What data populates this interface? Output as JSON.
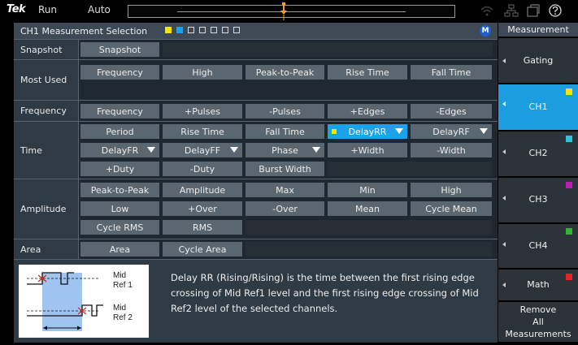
{
  "topbar": {
    "brand": "Tek",
    "run_state": "Run",
    "trigger_mode": "Auto",
    "icons": [
      "wifi-icon",
      "network-icon",
      "window-icon",
      "help-icon"
    ]
  },
  "panel": {
    "title": "CH1 Measurement Selection",
    "badge": "M",
    "square_colors": [
      "#f7e600",
      "#1aa3e8",
      "#d8d8d8",
      "#d8d8d8",
      "#d8d8d8",
      "#d8d8d8",
      "#d8d8d8"
    ]
  },
  "rows": {
    "snapshot": {
      "label": "Snapshot",
      "btn": "Snapshot"
    },
    "most_used": {
      "label": "Most Used",
      "btns": [
        "Frequency",
        "High",
        "Peak-to-Peak",
        "Rise Time",
        "Fall Time"
      ]
    },
    "frequency": {
      "label": "Frequency",
      "btns": [
        "Frequency",
        "+Pulses",
        "-Pulses",
        "+Edges",
        "-Edges"
      ]
    },
    "time": {
      "label": "Time",
      "r1": [
        "Period",
        "Rise Time",
        "Fall Time",
        "DelayRR",
        "DelayRF"
      ],
      "r2": [
        "DelayFR",
        "DelayFF",
        "Phase",
        "+Width",
        "-Width"
      ],
      "r3": [
        "+Duty",
        "-Duty",
        "Burst Width"
      ]
    },
    "amplitude": {
      "label": "Amplitude",
      "r1": [
        "Peak-to-Peak",
        "Amplitude",
        "Max",
        "Min",
        "High"
      ],
      "r2": [
        "Low",
        "+Over",
        "-Over",
        "Mean",
        "Cycle Mean"
      ],
      "r3": [
        "Cycle RMS",
        "RMS"
      ]
    },
    "area": {
      "label": "Area",
      "btns": [
        "Area",
        "Cycle Area"
      ]
    }
  },
  "description": {
    "text": "Delay RR (Rising/Rising) is the time between the first rising edge crossing of Mid Ref1 level and the first rising edge crossing of Mid Ref2 level of the selected channels.",
    "diagram_labels": {
      "mid1": "Mid",
      "ref1": "Ref 1",
      "mid2": "Mid",
      "ref2": "Ref 2"
    },
    "accent_color": "#1aa3e8"
  },
  "sidebar": {
    "header": "Measurement",
    "gating": "Gating",
    "channels": [
      {
        "label": "CH1",
        "color": "#f7e600",
        "active": true
      },
      {
        "label": "CH2",
        "color": "#27c6d9",
        "active": false
      },
      {
        "label": "CH3",
        "color": "#b61fb5",
        "active": false
      },
      {
        "label": "CH4",
        "color": "#2fb52f",
        "active": false
      },
      {
        "label": "Math",
        "color": "#e82121",
        "active": false
      }
    ],
    "remove_l1": "Remove",
    "remove_l2": "All",
    "remove_l3": "Measurements"
  }
}
